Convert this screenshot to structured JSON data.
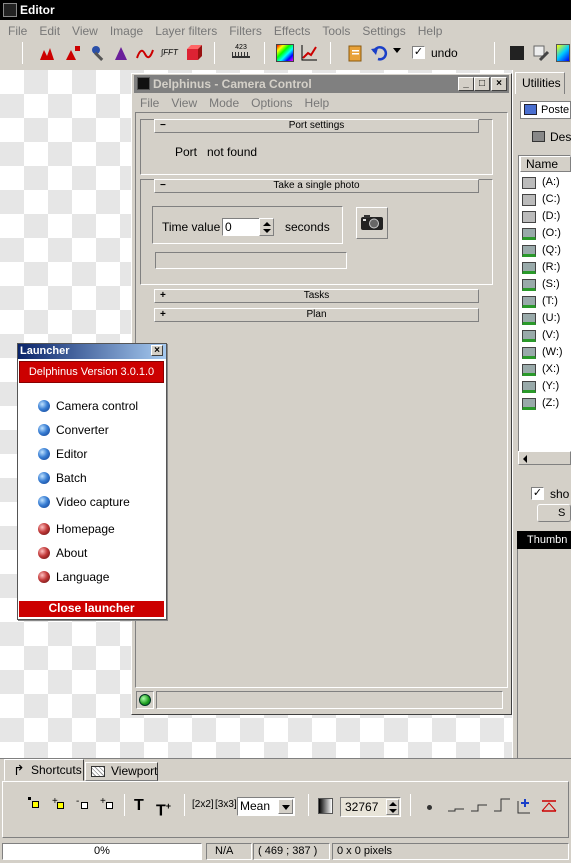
{
  "main_window": {
    "title": "Editor",
    "menu": [
      "File",
      "Edit",
      "View",
      "Image",
      "Layer filters",
      "Filters",
      "Effects",
      "Tools",
      "Settings",
      "Help"
    ],
    "toolbar": {
      "undo_label": "undo",
      "undo_checked": true,
      "ruler_number": "423"
    }
  },
  "camera_window": {
    "title": "Delphinus - Camera Control",
    "menu": [
      "File",
      "View",
      "Mode",
      "Options",
      "Help"
    ],
    "port_section": {
      "title": "Port settings",
      "toggle": "−",
      "port_label": "Port",
      "port_status": "not found"
    },
    "photo_section": {
      "title": "Take a single photo",
      "toggle": "−",
      "time_label": "Time value",
      "time_value": "0",
      "time_unit": "seconds"
    },
    "tasks_section": {
      "title": "Tasks",
      "toggle": "+"
    },
    "plan_section": {
      "title": "Plan",
      "toggle": "+"
    }
  },
  "launcher": {
    "title": "Launcher",
    "close_glyph": "×",
    "version": "Delphinus Version 3.0.1.0",
    "items": [
      {
        "label": "Camera control",
        "color": "blue"
      },
      {
        "label": "Converter",
        "color": "blue"
      },
      {
        "label": "Editor",
        "color": "blue"
      },
      {
        "label": "Batch",
        "color": "blue"
      },
      {
        "label": "Video capture",
        "color": "blue"
      },
      {
        "label": "Homepage",
        "color": "red"
      },
      {
        "label": "About",
        "color": "red"
      },
      {
        "label": "Language",
        "color": "red"
      }
    ],
    "close_button": "Close launcher",
    "accent": "#cc0000"
  },
  "right_panel": {
    "tab": "Utilities",
    "item1": "Poste",
    "item2": "Des",
    "column_header": "Name",
    "drives": [
      "(A:)",
      "(C:)",
      "(D:)",
      "(O:)",
      "(Q:)",
      "(R:)",
      "(S:)",
      "(T:)",
      "(U:)",
      "(V:)",
      "(W:)",
      "(X:)",
      "(Y:)",
      "(Z:)"
    ],
    "checkbox_label": "sho",
    "button_label": "S",
    "thumbnail_label": "Thumbn"
  },
  "bottom_tabs": {
    "shortcuts": "Shortcuts",
    "viewport": "Viewport"
  },
  "bottom_toolbar": {
    "zoom_2x2": "[2x2]",
    "zoom_3x3": "[3x3]",
    "mode_select": "Mean",
    "value_field": "32767"
  },
  "status_bar": {
    "progress": "0%",
    "progress_value": 0,
    "na": "N/A",
    "coords": "( 469 ; 387 )",
    "selection": "0 x 0 pixels"
  }
}
